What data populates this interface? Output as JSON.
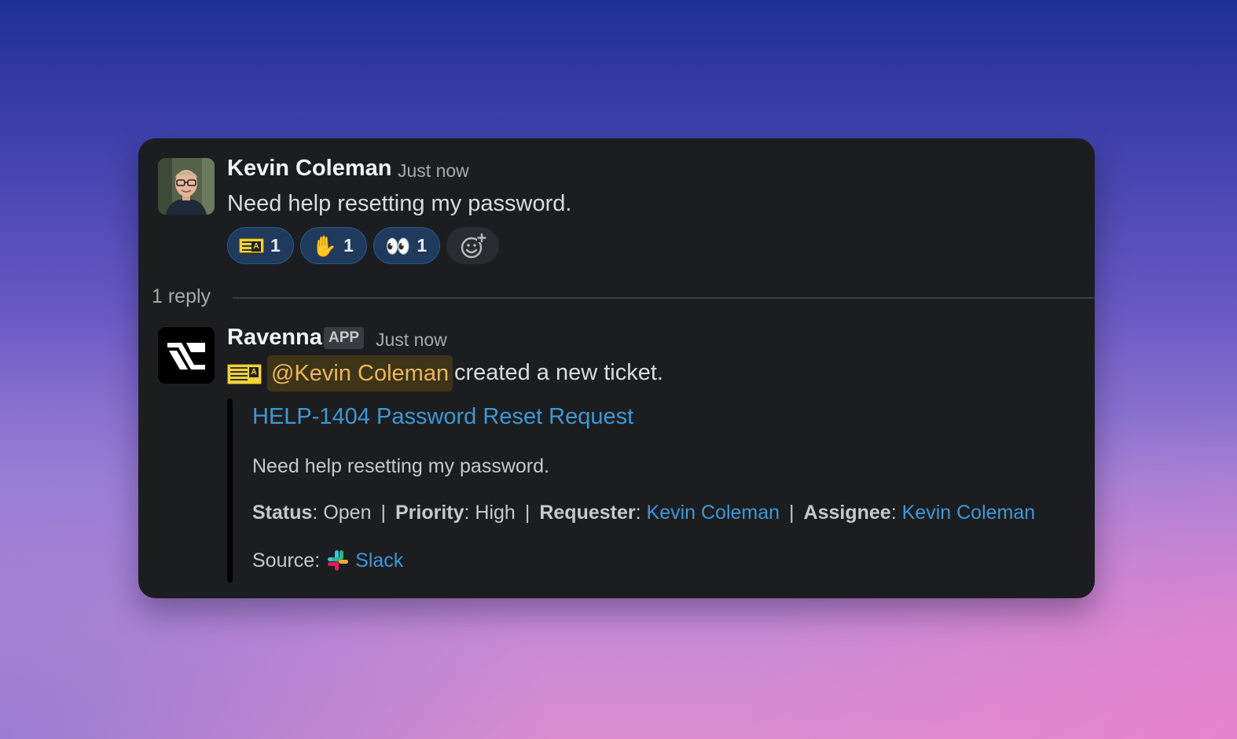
{
  "message1": {
    "author": "Kevin Coleman",
    "time": "Just now",
    "text": "Need help resetting my password.",
    "reactions": [
      {
        "emoji": "ticket",
        "count": "1"
      },
      {
        "emoji": "✋",
        "count": "1"
      },
      {
        "emoji": "👀",
        "count": "1"
      }
    ]
  },
  "thread": {
    "reply_count": "1 reply"
  },
  "message2": {
    "author": "Ravenna",
    "badge": "APP",
    "time": "Just now",
    "mention": "@Kevin Coleman",
    "text": "created a new ticket.",
    "attachment": {
      "title": "HELP-1404 Password Reset Request",
      "description": "Need help resetting my password.",
      "status_label": "Status",
      "status_value": "Open",
      "priority_label": "Priority",
      "priority_value": "High",
      "requester_label": "Requester",
      "requester_value": "Kevin Coleman",
      "assignee_label": "Assignee",
      "assignee_value": "Kevin Coleman",
      "separator": "|",
      "source_label": "Source:",
      "source_value": "Slack"
    }
  },
  "colors": {
    "link": "#3d98d4",
    "mention_text": "#e8b75a",
    "card_bg": "#1b1d21",
    "reaction_bg": "#1f3a5c"
  }
}
